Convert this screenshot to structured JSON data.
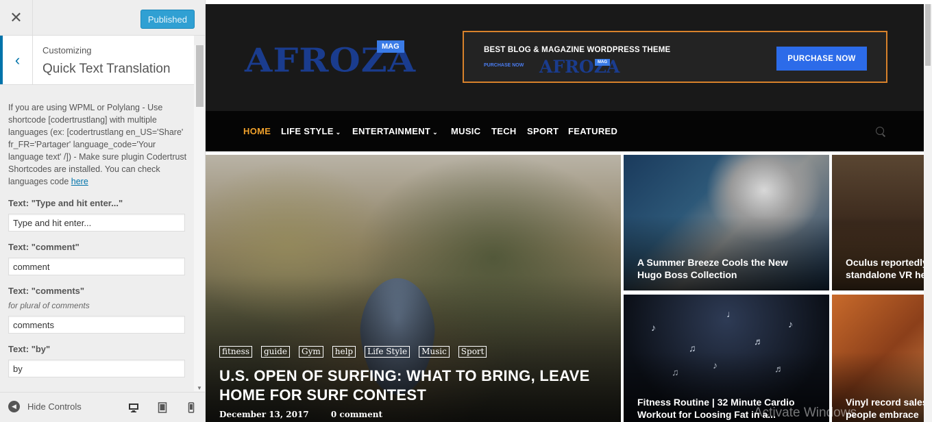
{
  "sidebar": {
    "close_icon": "close-icon",
    "publish_label": "Published",
    "customizing_label": "Customizing",
    "section_name": "Quick Text Translation",
    "description": "If you are using WPML or Polylang - Use shortcode [codertrustlang] with multiple languages (ex: [codertrustlang en_US='Share' fr_FR='Partager' language_code='Your language text' /]) - Make sure plugin Codertrust Shortcodes are installed. You can check languages code ",
    "description_link": "here",
    "controls": [
      {
        "label": "Text: \"Type and hit enter...\"",
        "note": "",
        "value": "Type and hit enter..."
      },
      {
        "label": "Text: \"comment\"",
        "note": "",
        "value": "comment"
      },
      {
        "label": "Text: \"comments\"",
        "note": "for plural of comments",
        "value": "comments"
      },
      {
        "label": "Text: \"by\"",
        "note": "",
        "value": "by"
      }
    ],
    "footer": {
      "hide_controls_label": "Hide Controls"
    }
  },
  "site": {
    "logo_text": "AFROZA",
    "logo_badge": "MAG",
    "banner": {
      "headline": "BEST BLOG & MAGAZINE WORDPRESS THEME",
      "sub": "PURCHASE NOW",
      "logo_text": "AFROZA",
      "logo_badge": "MAG",
      "button": "PURCHASE NOW"
    },
    "nav": [
      {
        "label": "HOME",
        "active": true,
        "dropdown": false
      },
      {
        "label": "LIFE STYLE",
        "active": false,
        "dropdown": true
      },
      {
        "label": "ENTERTAINMENT",
        "active": false,
        "dropdown": true
      },
      {
        "label": "MUSIC",
        "active": false,
        "dropdown": false
      },
      {
        "label": "TECH",
        "active": false,
        "dropdown": false
      },
      {
        "label": "SPORT",
        "active": false,
        "dropdown": false
      },
      {
        "label": "FEATURED",
        "active": false,
        "dropdown": false
      }
    ],
    "hero": {
      "tags": [
        "fitness",
        "guide",
        "Gym",
        "help",
        "Life Style",
        "Music",
        "Sport"
      ],
      "title": "U.S. OPEN OF SURFING: WHAT TO BRING, LEAVE HOME FOR SURF CONTEST",
      "date": "December 13, 2017",
      "comments": "0 comment"
    },
    "tiles": [
      {
        "title_line1": "A Summer Breeze Cools the New",
        "title_line2": "Hugo Boss Collection"
      },
      {
        "title_line1": "Oculus reportedly",
        "title_line2": "standalone VR he"
      },
      {
        "title_line1": "Fitness Routine | 32 Minute Cardio",
        "title_line2": "Workout for Loosing Fat in a..."
      },
      {
        "title_line1": "Vinyl record sales",
        "title_line2": "people embrace"
      }
    ]
  },
  "watermark": "Activate Windows",
  "colors": {
    "accent": "#0073aa",
    "publish": "#30a0d3",
    "nav_active": "#f0a12b",
    "logo": "#1a3c8e",
    "banner_button": "#2c6be9"
  }
}
